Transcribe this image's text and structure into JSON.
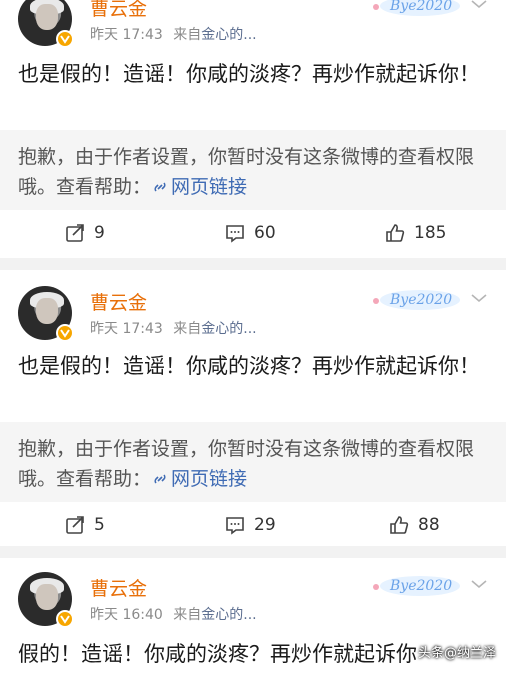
{
  "posts": [
    {
      "username": "曹云金",
      "time": "昨天 17:43",
      "source_prefix": "来自",
      "source_name": "金心的...",
      "badge_text": "Bye2020",
      "text": "也是假的！造谣！你咸的淡疼？再炒作就起诉你！",
      "notice_text": "抱歉，由于作者设置，你暂时没有这条微博的查看权限哦。查看帮助：",
      "notice_link": "网页链接",
      "reposts": "9",
      "comments": "60",
      "likes": "185"
    },
    {
      "username": "曹云金",
      "time": "昨天 17:43",
      "source_prefix": "来自",
      "source_name": "金心的...",
      "badge_text": "Bye2020",
      "text": "也是假的！造谣！你咸的淡疼？再炒作就起诉你！",
      "notice_text": "抱歉，由于作者设置，你暂时没有这条微博的查看权限哦。查看帮助：",
      "notice_link": "网页链接",
      "reposts": "5",
      "comments": "29",
      "likes": "88"
    },
    {
      "username": "曹云金",
      "time": "昨天 16:40",
      "source_prefix": "来自",
      "source_name": "金心的...",
      "badge_text": "Bye2020",
      "text": "假的！造谣！你咸的淡疼？再炒作就起诉你"
    }
  ],
  "watermark": "头条@纳兰泽",
  "colors": {
    "username": "#e8700a",
    "link": "#3f6bb4",
    "verified_badge": "#f7a600"
  }
}
